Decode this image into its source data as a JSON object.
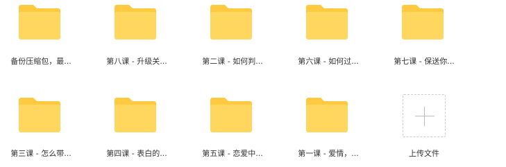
{
  "colors": {
    "folder_back": "#FFC940",
    "folder_front": "#FFD75E",
    "upload_border": "#C9CCD1",
    "plus": "#B8BCC2"
  },
  "folders": [
    {
      "label": "备份压缩包，最...",
      "icon": "folder-icon"
    },
    {
      "label": "第八课 - 升级关...",
      "icon": "folder-icon"
    },
    {
      "label": "第二课 - 如何判...",
      "icon": "folder-icon"
    },
    {
      "label": "第六课 - 如何过...",
      "icon": "folder-icon"
    },
    {
      "label": "第七课 - 保送你...",
      "icon": "folder-icon"
    },
    {
      "label": "第三课 - 怎么带...",
      "icon": "folder-icon"
    },
    {
      "label": "第四课 - 表白的...",
      "icon": "folder-icon"
    },
    {
      "label": "第五课 - 恋爱中...",
      "icon": "folder-icon"
    },
    {
      "label": "第一课 - 爱情，...",
      "icon": "folder-icon"
    }
  ],
  "upload": {
    "label": "上传文件",
    "icon": "plus-icon"
  }
}
